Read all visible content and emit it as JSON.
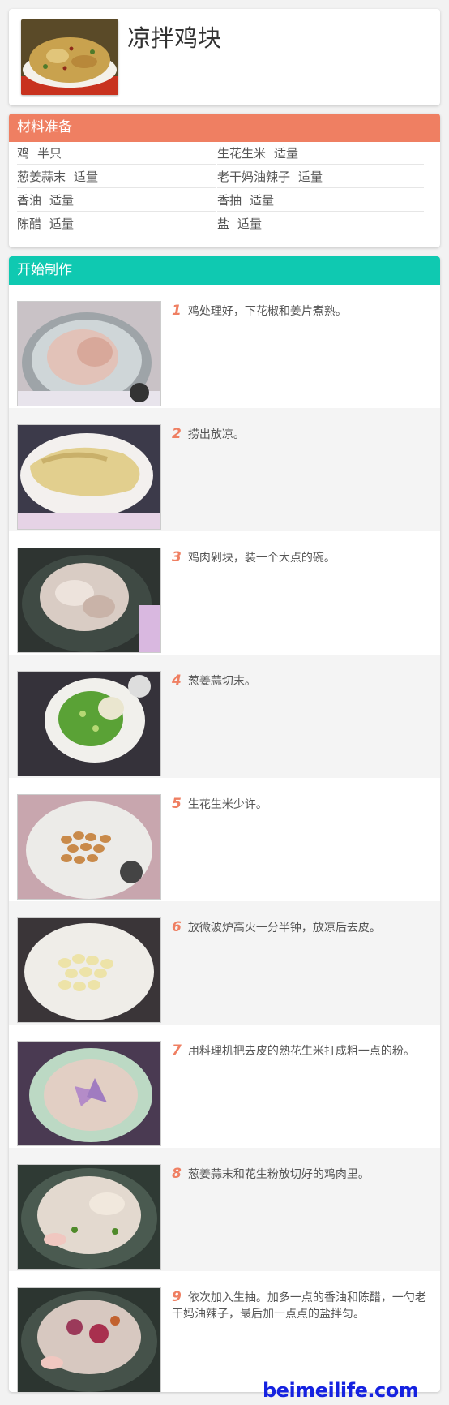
{
  "recipe": {
    "title": "凉拌鸡块"
  },
  "colors": {
    "ingredients_header": "#ef7f62",
    "steps_header": "#0fc9b1",
    "step_number": "#ef7f62",
    "brand": "#1522e0"
  },
  "ingredients_section": {
    "title": "材料准备",
    "items": [
      {
        "name": "鸡",
        "amount": "半只"
      },
      {
        "name": "生花生米",
        "amount": "适量"
      },
      {
        "name": "葱姜蒜末",
        "amount": "适量"
      },
      {
        "name": "老干妈油辣子",
        "amount": "适量"
      },
      {
        "name": "香油",
        "amount": "适量"
      },
      {
        "name": "香抽",
        "amount": "适量"
      },
      {
        "name": "陈醋",
        "amount": "适量"
      },
      {
        "name": "盐",
        "amount": "适量"
      }
    ]
  },
  "steps_section": {
    "title": "开始制作",
    "steps": [
      {
        "num": "1",
        "text": "鸡处理好，下花椒和姜片煮熟。"
      },
      {
        "num": "2",
        "text": "捞出放凉。"
      },
      {
        "num": "3",
        "text": "鸡肉剁块，装一个大点的碗。"
      },
      {
        "num": "4",
        "text": "葱姜蒜切末。"
      },
      {
        "num": "5",
        "text": "生花生米少许。"
      },
      {
        "num": "6",
        "text": "放微波炉高火一分半钟，放凉后去皮。"
      },
      {
        "num": "7",
        "text": "用料理机把去皮的熟花生米打成粗一点的粉。"
      },
      {
        "num": "8",
        "text": "葱姜蒜末和花生粉放切好的鸡肉里。"
      },
      {
        "num": "9",
        "text": "依次加入生抽。加多一点的香油和陈醋，一勺老干妈油辣子，最后加一点点的盐拌匀。"
      }
    ]
  },
  "brand": "beimeilife.com"
}
